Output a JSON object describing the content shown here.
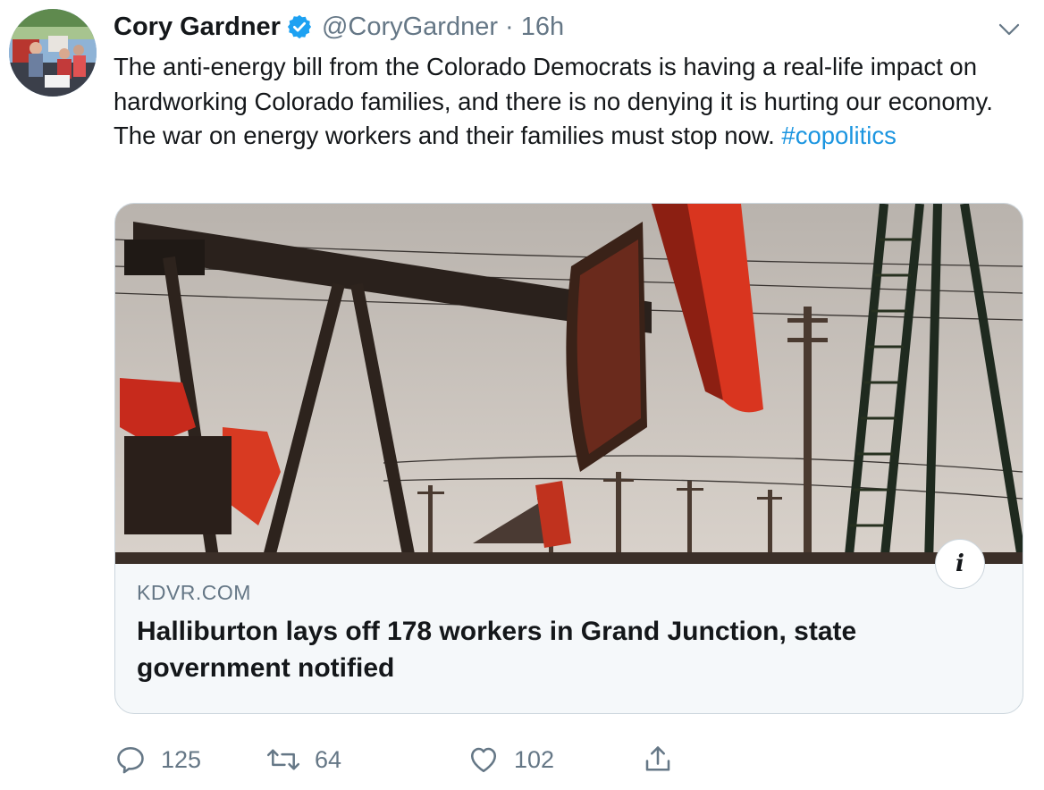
{
  "author": {
    "display_name": "Cory Gardner",
    "handle": "@CoryGardner",
    "separator": "·",
    "timestamp": "16h",
    "verified": true
  },
  "tweet": {
    "text": "The anti-energy bill from the Colorado Democrats is having a real-life impact on hardworking Colorado families, and there is no denying it is hurting our economy. The war on energy workers and their families must stop now.",
    "hashtag": "#copolitics"
  },
  "card": {
    "domain": "KDVR.COM",
    "title": "Halliburton lays off 178 workers in Grand Junction, state government notified",
    "info_label": "i"
  },
  "actions": {
    "replies": "125",
    "retweets": "64",
    "likes": "102"
  },
  "colors": {
    "text": "#14171a",
    "secondary": "#657786",
    "link": "#1b95e0",
    "verified": "#1da1f2",
    "card_border": "#ccd6dd",
    "card_background": "#f5f8fa"
  },
  "icons": {
    "verified": "verified-badge-icon",
    "menu": "chevron-down-icon",
    "reply": "reply-icon",
    "retweet": "retweet-icon",
    "like": "heart-icon",
    "share": "share-icon"
  }
}
